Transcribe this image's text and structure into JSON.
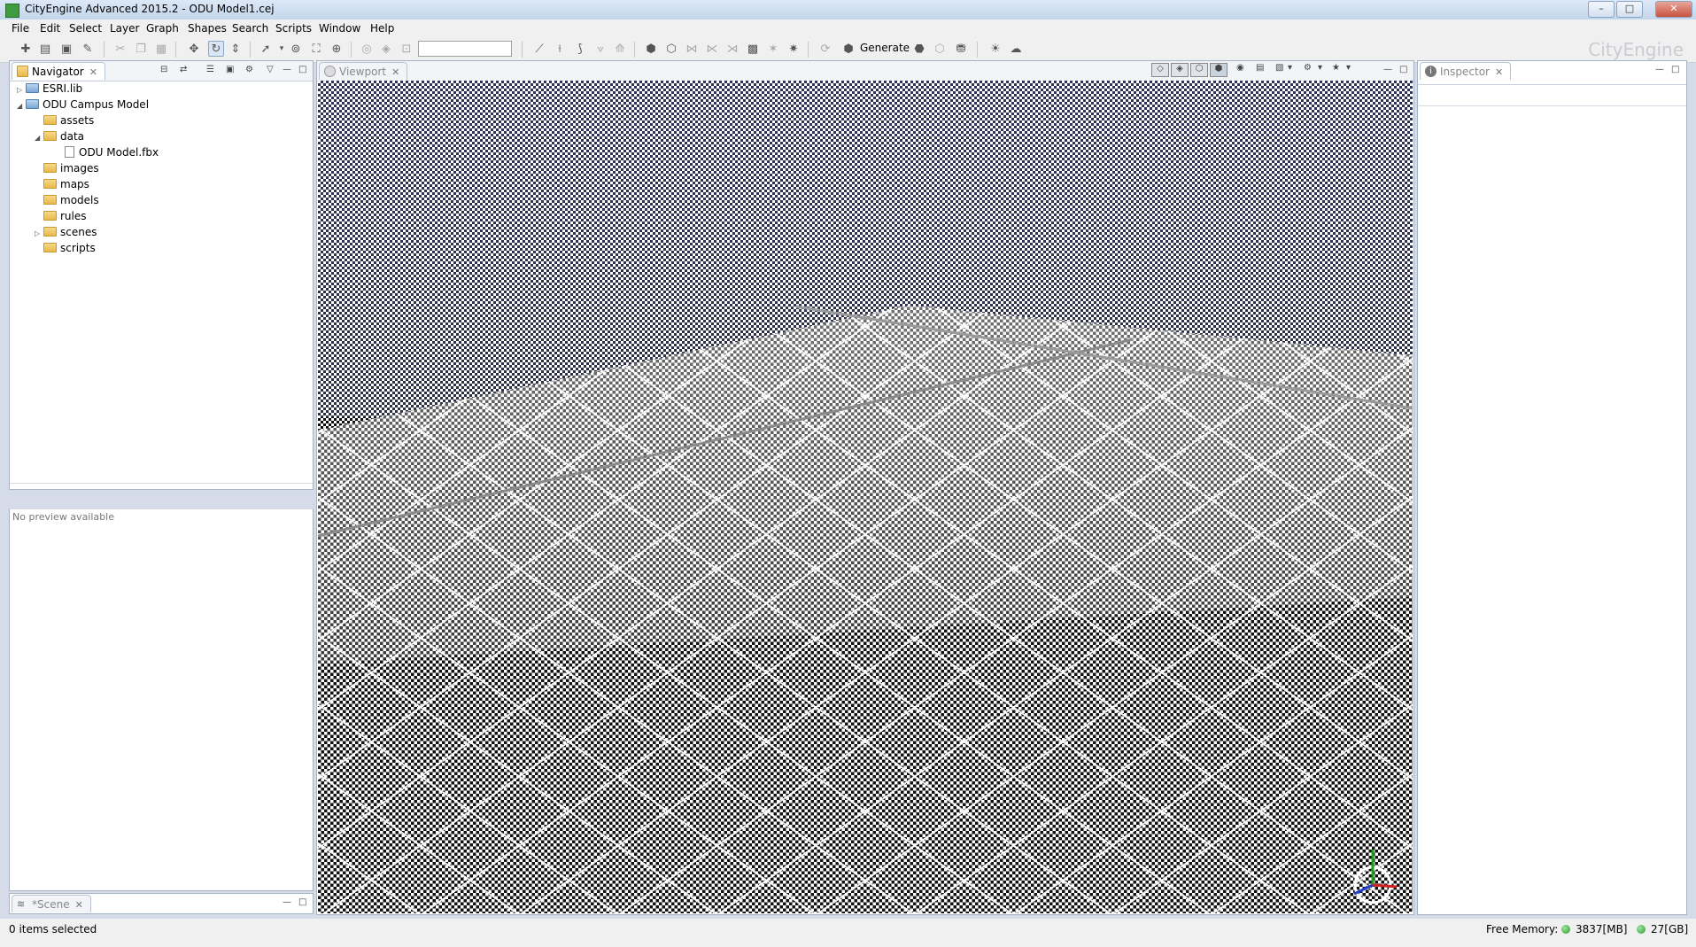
{
  "window": {
    "title": "CityEngine Advanced 2015.2 - ODU Model1.cej",
    "buttons": {
      "minimize": "–",
      "maximize": "□",
      "close": "✕"
    }
  },
  "menu": {
    "items": [
      "File",
      "Edit",
      "Select",
      "Layer",
      "Graph",
      "Shapes",
      "Search",
      "Scripts",
      "Window",
      "Help"
    ]
  },
  "toolbar": {
    "search_value": "",
    "generate_label": "Generate",
    "brand": "CityEngine"
  },
  "navigator": {
    "tab_label": "Navigator",
    "tree": [
      {
        "label": "ESRI.lib",
        "expander": "▷",
        "icon": "project-folder-icon"
      },
      {
        "label": "ODU Campus Model",
        "expander": "◢",
        "icon": "project-folder-icon"
      },
      {
        "label": "assets",
        "expander": "",
        "icon": "folder-icon"
      },
      {
        "label": "data",
        "expander": "◢",
        "icon": "folder-icon"
      },
      {
        "label": "ODU Model.fbx",
        "expander": "",
        "icon": "file-icon"
      },
      {
        "label": "images",
        "expander": "",
        "icon": "folder-icon"
      },
      {
        "label": "maps",
        "expander": "",
        "icon": "folder-icon"
      },
      {
        "label": "models",
        "expander": "",
        "icon": "folder-icon"
      },
      {
        "label": "rules",
        "expander": "",
        "icon": "folder-icon"
      },
      {
        "label": "scenes",
        "expander": "▷",
        "icon": "folder-icon"
      },
      {
        "label": "scripts",
        "expander": "",
        "icon": "folder-icon"
      }
    ],
    "preview_text": "No preview available"
  },
  "scene_panel": {
    "tab_label": "*Scene"
  },
  "viewport": {
    "tab_label": "Viewport"
  },
  "inspector": {
    "tab_label": "Inspector"
  },
  "statusbar": {
    "selection": "0 items selected",
    "free_memory_label": "Free Memory:",
    "memory_value": "3837[MB]",
    "disk_value": "27[GB]"
  },
  "colors": {
    "accent": "#3f9b3f",
    "panel_border": "#a7b3c4",
    "sky_tint": "#7080e0"
  }
}
